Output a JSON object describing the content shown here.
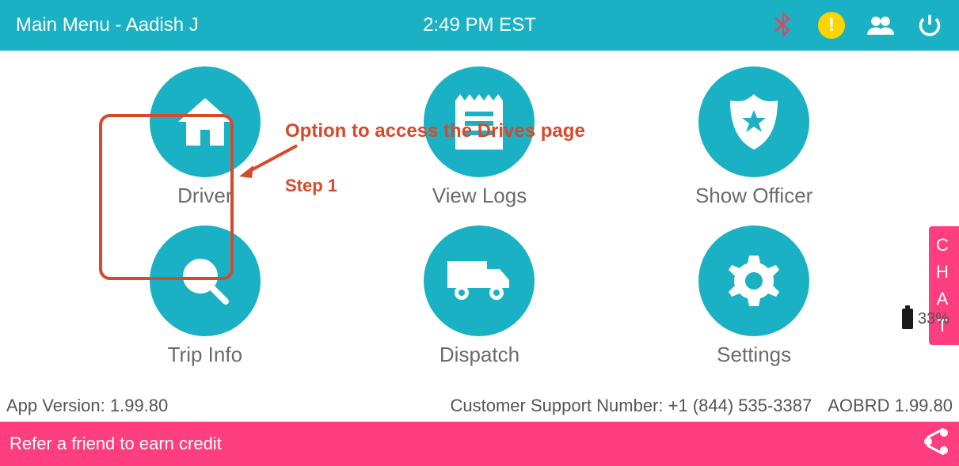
{
  "topbar": {
    "title": "Main Menu - Aadish J",
    "time": "2:49 PM EST",
    "alert_glyph": "!"
  },
  "menu": [
    {
      "label": "Driver",
      "icon": "home"
    },
    {
      "label": "View Logs",
      "icon": "logs"
    },
    {
      "label": "Show Officer",
      "icon": "badge"
    },
    {
      "label": "Trip Info",
      "icon": "search"
    },
    {
      "label": "Dispatch",
      "icon": "truck"
    },
    {
      "label": "Settings",
      "icon": "gear"
    }
  ],
  "annotation": {
    "title": "Option to access the Drives page",
    "step": "Step 1"
  },
  "chat_tab": {
    "c": "C",
    "h": "H",
    "a": "A",
    "t": "T"
  },
  "battery_pct": "33%",
  "info": {
    "version": "App Version: 1.99.80",
    "support": "Customer Support Number: +1 (844) 535-3387",
    "aobrd": "AOBRD 1.99.80"
  },
  "footer": {
    "text": "Refer a friend to earn credit"
  }
}
